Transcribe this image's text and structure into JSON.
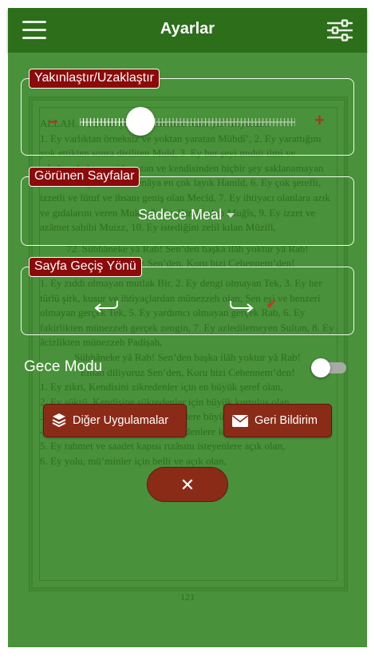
{
  "header": {
    "title": "Ayarlar",
    "menu_icon": "hamburger-menu-icon",
    "settings_icon": "sliders-icon"
  },
  "colors": {
    "header": "#2c6e1a",
    "background": "#49913a",
    "label": "#8c0a0a",
    "button": "#8a2b18",
    "accent_red": "#c0392b"
  },
  "zoom": {
    "label": "Yakınlaştır/Uzaklaştır",
    "minus_symbol": "−",
    "plus_symbol": "+",
    "level": 0.28
  },
  "visible_pages": {
    "label": "Görünen Sayfalar",
    "selected": "Sadece Meal"
  },
  "page_turn": {
    "label": "Sayfa Geçiş Yönü",
    "options": [
      "left",
      "right"
    ],
    "selected": "right",
    "check_symbol": "✔"
  },
  "night_mode": {
    "label": "Gece Modu",
    "enabled": false
  },
  "buttons": {
    "other_apps": "Diğer Uygulamalar",
    "feedback": "Geri Bildirim",
    "close_symbol": "✕"
  },
  "background_page": {
    "paragraphs": [
      "ALLAH… , Senin yüce isimlerinle Sana yalvarıyorum:",
      "1. Ey varlıktan örneksiz ve yoktan yaratan Mübdî’, 2. Ey yarattığını yok ettikten sonra diriliten Muîd, 3. Ey her şeyi muhit ilmi ve sıfatlarıyla her şeyi kuşatan ve kendisinden hiçbir şey saklanamayan Muhît, 5. Ey hamd ve senâya en çok layık Hamîd, 6. Ey çok şerefli, izzetli ve lütuf ve ihsanı geniş olan Mecîd, 7. Ey ihtiyacı olanlara azık ve gıdalarını veren Mukît, 8. Ey dâimî kalıcı Muğîs, 9. Ey izzet ve azâmet sahibi Muizz, 10. Ey istediğini zelil kılan Müzill,"
    ],
    "center_line_1": "72. Sübhâneke yâ Rab! Sen’den başka ilâh yoktur yâ Rab!",
    "center_line_2": "Emân diliyoruz Sen’den, Koru bizi Cehennem’den!",
    "paragraphs_2": [
      "1. Ey zıddı olmayan mutlak Bir, 2. Ey dengi olmayan Tek, 3. Ey her türlü şirk, kusur ve ihtiyaçlardan münezzeh olan, Sen eşi ve benzeri olmayan gerçek Tek, 5. Ey yardımcı olmayan gerçek Rab, 6. Ey fakirlikten münezzeh gerçek zengin, 7. Ey azledilemeyen Sultan, 8. Ey âcizlikten münezzeh Padişah,"
    ],
    "center_line_3": "Sübhâneke yâ Rab! Sen’den başka ilâh yoktur yâ Rab!",
    "center_line_4": "Emân diliyoruz Sen’den, Koru bizi Cehennem’den!",
    "list": [
      "1. Ey zikri, Kendisini zikredenler için en büyük şeref olan,",
      "2. Ey şükrü, Kendisine şükredenler için büyük kurtuluş olan,",
      "3. Ey hamdi, Kendisine hamd edenlere büyük iftihâr vesilesi olan,",
      "4. Ey Kendisine itaat etmek, itaat edenlere kurtuluş olan,",
      "5. Ey rahmet ve saadet kapısı rızâsını isteyenlere açık olan,",
      "6. Ey yolu, mü’minler için belli ve açık olan,"
    ],
    "page_number": "121"
  }
}
